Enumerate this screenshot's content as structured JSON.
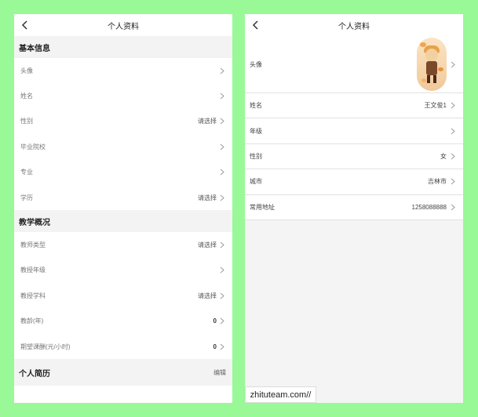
{
  "left_screen": {
    "title": "个人资料",
    "basic_section": "基本信息",
    "basic_rows": [
      {
        "label": "头像",
        "value": ""
      },
      {
        "label": "姓名",
        "value": ""
      },
      {
        "label": "性别",
        "value": "请选择"
      },
      {
        "label": "毕业院校",
        "value": ""
      },
      {
        "label": "专业",
        "value": ""
      },
      {
        "label": "学历",
        "value": "请选择"
      }
    ],
    "teaching_section": "教学概况",
    "teaching_rows": [
      {
        "label": "教师类型",
        "value": "请选择"
      },
      {
        "label": "教授年级",
        "value": ""
      },
      {
        "label": "教授学科",
        "value": "请选择"
      },
      {
        "label": "教龄(年)",
        "value": "0"
      },
      {
        "label": "期望课酬(元/小时)",
        "value": "0"
      }
    ],
    "resume_section": "个人简历",
    "resume_edit": "编辑"
  },
  "right_screen": {
    "title": "个人资料",
    "rows": [
      {
        "label": "头像",
        "value": ""
      },
      {
        "label": "姓名",
        "value": "王文俊1"
      },
      {
        "label": "年级",
        "value": ""
      },
      {
        "label": "性别",
        "value": "女"
      },
      {
        "label": "城市",
        "value": "吉林市"
      },
      {
        "label": "常用地址",
        "value": "1258088888"
      }
    ]
  },
  "watermark": "zhituteam.com//",
  "colors": {
    "background": "#98f996",
    "section": "#f3f3f3",
    "panel": "#ffffff"
  },
  "icons": [
    "back-arrow-icon",
    "chevron-right-icon",
    "avatar-image"
  ]
}
